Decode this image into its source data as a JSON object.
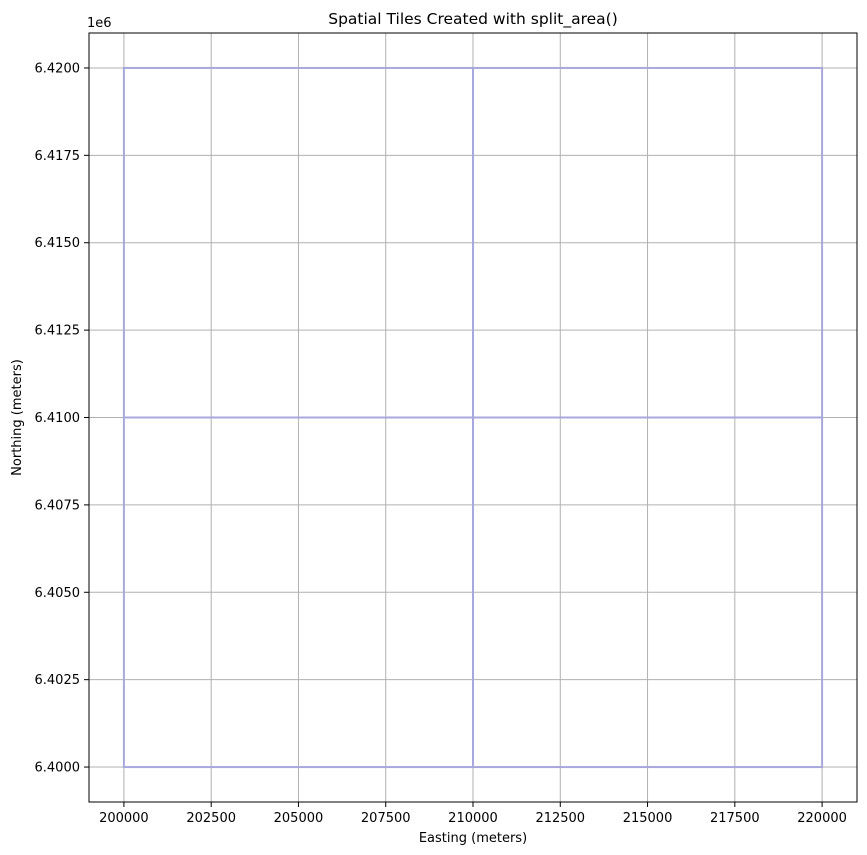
{
  "chart_data": {
    "type": "line",
    "title": "Spatial Tiles Created with split_area()",
    "xlabel": "Easting (meters)",
    "ylabel": "Northing (meters)",
    "y_offset_label": "1e6",
    "xlim": [
      199000,
      221000
    ],
    "ylim": [
      6399000,
      6421000
    ],
    "x_ticks": [
      200000,
      202500,
      205000,
      207500,
      210000,
      212500,
      215000,
      217500,
      220000
    ],
    "x_tick_labels": [
      "200000",
      "202500",
      "205000",
      "207500",
      "210000",
      "212500",
      "215000",
      "217500",
      "220000"
    ],
    "y_ticks": [
      6400000,
      6402500,
      6405000,
      6407500,
      6410000,
      6412500,
      6415000,
      6417500,
      6420000
    ],
    "y_tick_labels": [
      "6.4000",
      "6.4025",
      "6.4050",
      "6.4075",
      "6.4100",
      "6.4125",
      "6.4150",
      "6.4175",
      "6.4200"
    ],
    "grid": true,
    "tile_color": "#a8a8dc",
    "tiles": [
      {
        "xmin": 200000,
        "xmax": 210000,
        "ymin": 6400000,
        "ymax": 6410000
      },
      {
        "xmin": 210000,
        "xmax": 220000,
        "ymin": 6400000,
        "ymax": 6410000
      },
      {
        "xmin": 200000,
        "xmax": 210000,
        "ymin": 6410000,
        "ymax": 6420000
      },
      {
        "xmin": 210000,
        "xmax": 220000,
        "ymin": 6410000,
        "ymax": 6420000
      }
    ]
  }
}
